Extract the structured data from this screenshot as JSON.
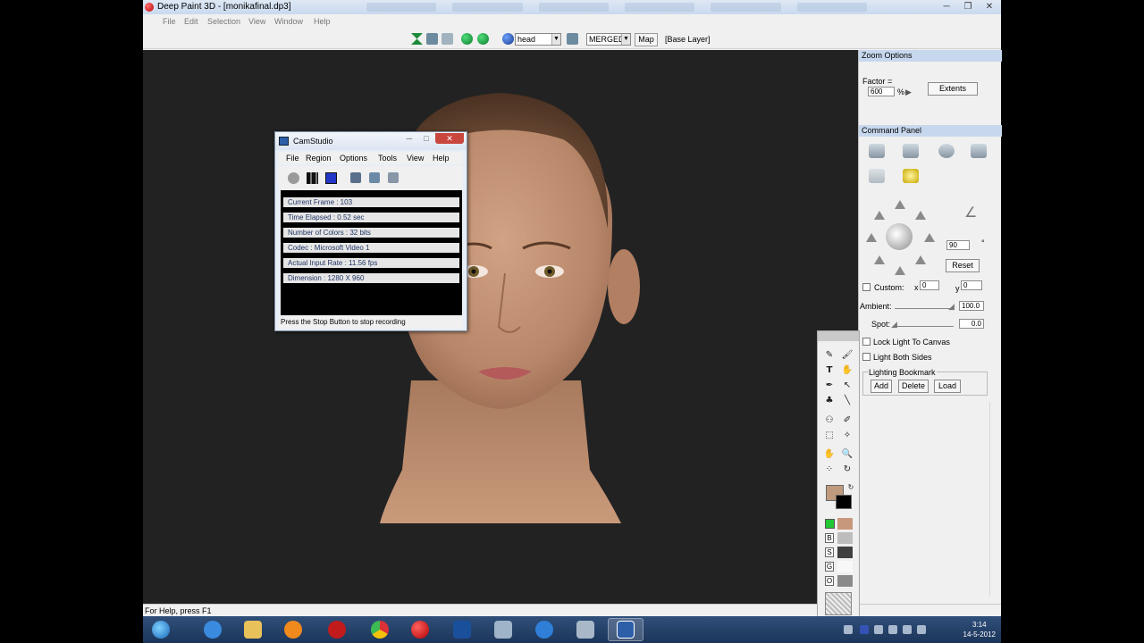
{
  "window": {
    "title": "Deep Paint 3D - [monikafinal.dp3]"
  },
  "menu": [
    "File",
    "Edit",
    "Selection",
    "View",
    "Window",
    "Help"
  ],
  "toolbar": {
    "object_select": "head",
    "layer_mode_select": "MERGED",
    "map_button": "Map",
    "layer_label": "[Base Layer]"
  },
  "zoom_options": {
    "header": "Zoom Options",
    "factor_label": "Factor =",
    "factor_value": "600",
    "percent": "%",
    "extents_button": "Extents"
  },
  "command_panel": {
    "header": "Command Panel",
    "angle_value": "90",
    "degree": "°",
    "reset_button": "Reset",
    "custom_label": "Custom:",
    "x_label": "x",
    "x_value": "0",
    "y_label": "y",
    "y_value": "0",
    "ambient_label": "Ambient:",
    "ambient_value": "100.0",
    "spot_label": "Spot:",
    "spot_value": "0.0",
    "lock_light_label": "Lock Light To Canvas",
    "light_both_label": "Light Both Sides",
    "bookmark_label": "Lighting Bookmark",
    "add_button": "Add",
    "delete_button": "Delete",
    "load_button": "Load"
  },
  "toolbox": {
    "primary_color": "#c09a7c",
    "secondary_color": "#000000",
    "swatches": [
      {
        "label": "",
        "color": "#c8987c"
      },
      {
        "label": "B",
        "color": "#bdbdbd"
      },
      {
        "label": "S",
        "color": "#404040"
      },
      {
        "label": "G",
        "color": "#f8f8f8"
      },
      {
        "label": "O",
        "color": "#8a8a8a"
      }
    ]
  },
  "status": {
    "text": "For Help, press F1"
  },
  "camstudio": {
    "title": "CamStudio",
    "menu": [
      "File",
      "Region",
      "Options",
      "Tools",
      "View",
      "Help"
    ],
    "rows": [
      "Current Frame : 103",
      "Time Elapsed : 0.52 sec",
      "Number of Colors : 32 bits",
      "Codec : Microsoft Video 1",
      "Actual Input Rate : 11.56 fps",
      "Dimension : 1280 X 960"
    ],
    "status": "Press the Stop Button to stop recording"
  },
  "taskbar": {
    "time": "3:14",
    "date": "14-5-2012",
    "apps": [
      "start-orb",
      "internet-explorer",
      "file-explorer",
      "media-player",
      "acrobat",
      "chrome",
      "deep-paint",
      "photoshop",
      "network",
      "thunderbolt",
      "control-panel",
      "camstudio"
    ]
  }
}
